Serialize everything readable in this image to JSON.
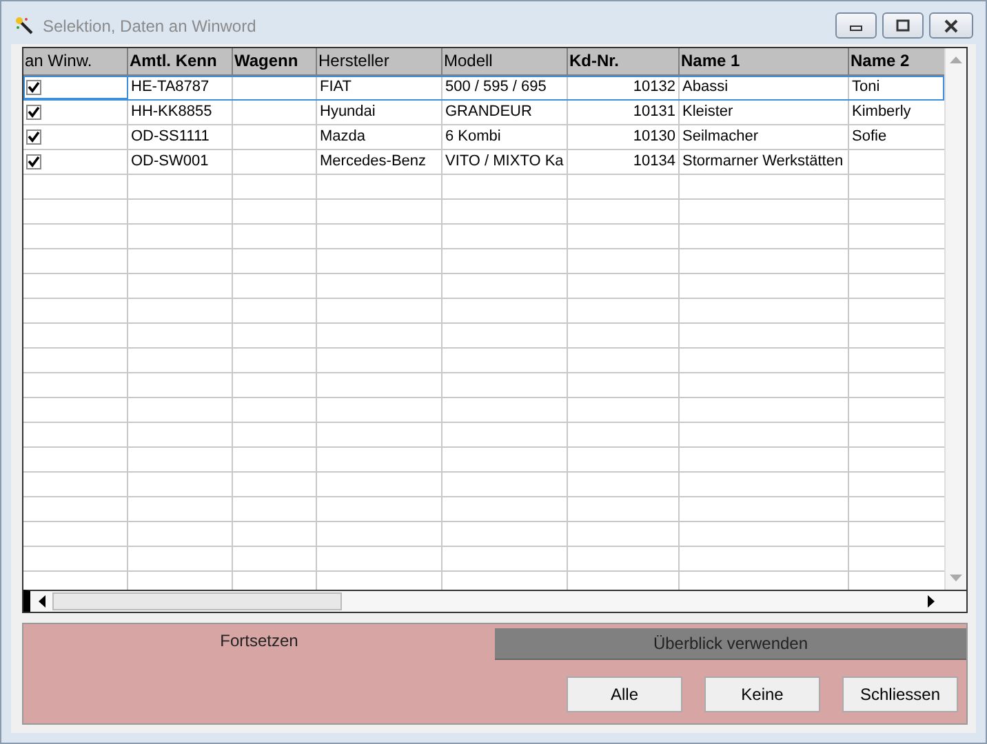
{
  "window": {
    "title": "Selektion, Daten an Winword"
  },
  "table": {
    "columns": [
      {
        "label": "an Winw.",
        "bold": false
      },
      {
        "label": "Amtl. Kenn",
        "bold": true
      },
      {
        "label": "Wagenn",
        "bold": true
      },
      {
        "label": "Hersteller",
        "bold": false
      },
      {
        "label": "Modell",
        "bold": false
      },
      {
        "label": "Kd-Nr.",
        "bold": true
      },
      {
        "label": "Name 1",
        "bold": true
      },
      {
        "label": "Name 2",
        "bold": true
      }
    ],
    "rows": [
      {
        "checked": true,
        "focused": true,
        "cells": [
          "",
          "HE-TA8787",
          "",
          "FIAT",
          "500 / 595 / 695",
          "10132",
          "Abassi",
          "Toni"
        ]
      },
      {
        "checked": true,
        "focused": false,
        "cells": [
          "",
          "HH-KK8855",
          "",
          "Hyundai",
          "GRANDEUR",
          "10131",
          "Kleister",
          "Kimberly"
        ]
      },
      {
        "checked": true,
        "focused": false,
        "cells": [
          "",
          "OD-SS1111",
          "",
          "Mazda",
          "6 Kombi",
          "10130",
          "Seilmacher",
          "Sofie"
        ]
      },
      {
        "checked": true,
        "focused": false,
        "cells": [
          "",
          "OD-SW001",
          "",
          "Mercedes-Benz",
          "VITO / MIXTO Ka",
          "10134",
          "Stormarner Werkstätten",
          ""
        ]
      }
    ]
  },
  "tabs": [
    {
      "label": "Fortsetzen",
      "selected": true
    },
    {
      "label": "Überblick verwenden",
      "selected": false
    }
  ],
  "buttons": [
    "Alle",
    "Keine",
    "Schliessen"
  ]
}
